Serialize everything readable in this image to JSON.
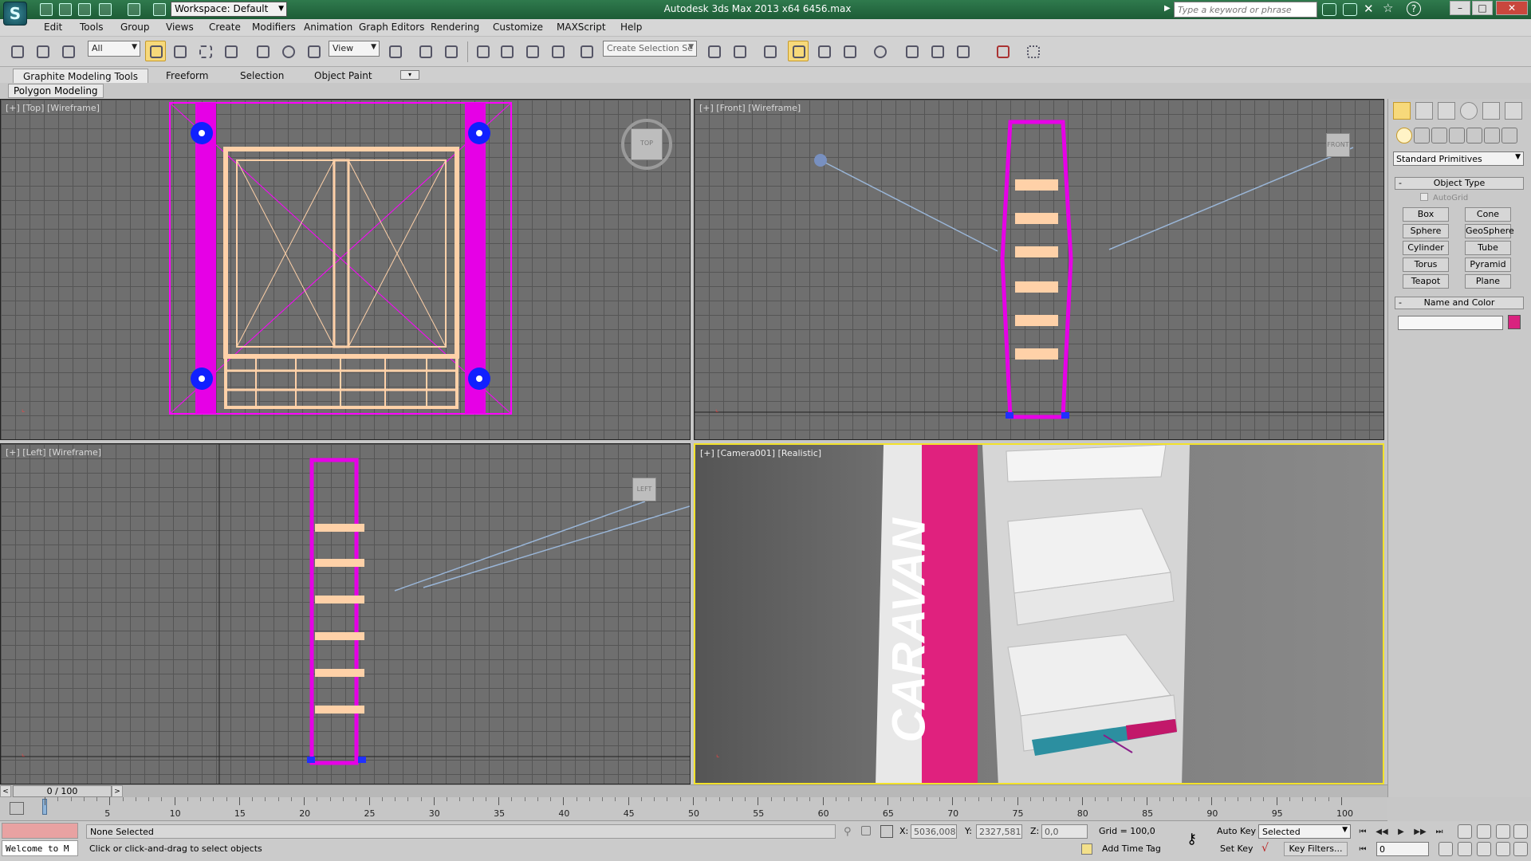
{
  "titlebar": {
    "app_logo": "S",
    "workspace": "Workspace: Default",
    "title": "Autodesk 3ds Max  2013 x64     6456.max",
    "search_placeholder": "Type a keyword or phrase"
  },
  "menu": [
    "Edit",
    "Tools",
    "Group",
    "Views",
    "Create",
    "Modifiers",
    "Animation",
    "Graph Editors",
    "Rendering",
    "Customize",
    "MAXScript",
    "Help"
  ],
  "toolbar": {
    "filter": "All",
    "ref_coord": "View",
    "selection_set_placeholder": "Create Selection Se"
  },
  "ribbon": {
    "tabs": [
      "Graphite Modeling Tools",
      "Freeform",
      "Selection",
      "Object Paint"
    ],
    "active_panel": "Polygon Modeling"
  },
  "viewports": {
    "top": {
      "label": "[+] [Top] [Wireframe]",
      "cube": "TOP"
    },
    "front": {
      "label": "[+] [Front] [Wireframe]",
      "cube": "FRONT"
    },
    "left": {
      "label": "[+] [Left] [Wireframe]",
      "cube": "LEFT"
    },
    "camera": {
      "label": "[+] [Camera001] [Realistic]",
      "sign_text": "CARAVAN"
    }
  },
  "command_panel": {
    "category": "Standard Primitives",
    "object_type_title": "Object Type",
    "autogrid": "AutoGrid",
    "primitives": [
      "Box",
      "Cone",
      "Sphere",
      "GeoSphere",
      "Cylinder",
      "Tube",
      "Torus",
      "Pyramid",
      "Teapot",
      "Plane"
    ],
    "name_color_title": "Name and Color",
    "swatch_color": "#d9237f"
  },
  "timeline": {
    "frame_counter": "0 / 100",
    "ticks": [
      5,
      10,
      15,
      20,
      25,
      30,
      35,
      40,
      45,
      50,
      55,
      60,
      65,
      70,
      75,
      80,
      85,
      90,
      95,
      100
    ]
  },
  "status": {
    "welcome": "Welcome to M",
    "selection": "None Selected",
    "prompt": "Click or click-and-drag to select objects",
    "x_label": "X:",
    "x_value": "5036,008",
    "y_label": "Y:",
    "y_value": "2327,581",
    "z_label": "Z:",
    "z_value": "0,0",
    "grid": "Grid = 100,0",
    "add_time_tag": "Add Time Tag",
    "auto_key": "Auto Key",
    "set_key": "Set Key",
    "key_mode": "Selected",
    "key_filters": "Key Filters...",
    "current_frame": "0"
  }
}
